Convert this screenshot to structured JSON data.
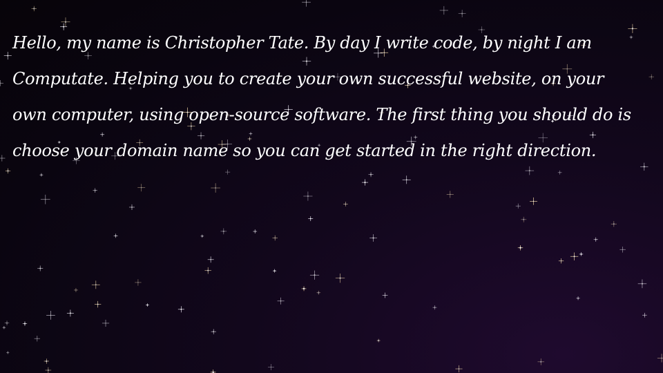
{
  "background": {
    "gradient_colors": [
      "#070409",
      "#12071c",
      "#1f0a2e"
    ],
    "star_color": "#e8e4f0",
    "star_glint_color": "#f3d9a8"
  },
  "intro": {
    "lines": [
      "Hello, my name is Christopher Tate. By day I write code, by night I am",
      "Computate. Helping you to create your own successful website, on your",
      "own computer, using open-source software. The first thing you should do is",
      "choose your domain name so you can get started in the right direction."
    ]
  }
}
